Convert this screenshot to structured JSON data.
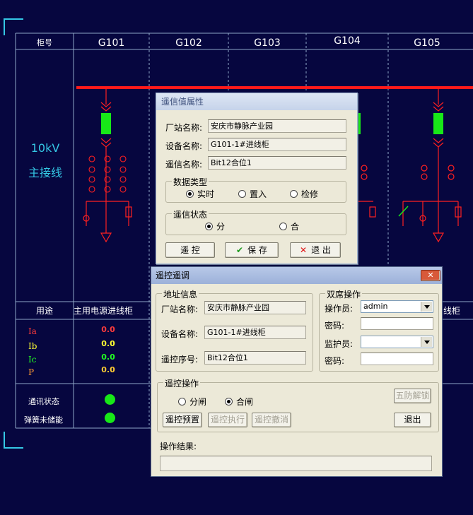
{
  "table": {
    "header_label": "柜号",
    "cabinets": [
      "G101",
      "G102",
      "G103",
      "G104",
      "G105"
    ],
    "bus_title_line1": "10kV",
    "bus_title_line2": "主接线",
    "purpose_label": "用途",
    "purpose_col1": "主用电源进线柜",
    "purpose_col5_partial": "线柜",
    "measurements": [
      {
        "label": "Ia",
        "value": "0.0",
        "label_color": "#ff3b3b",
        "value_color": "#ff3b3b"
      },
      {
        "label": "Ib",
        "value": "0.0",
        "label_color": "#ffff33",
        "value_color": "#ffff33"
      },
      {
        "label": "Ic",
        "value": "0.0",
        "label_color": "#22ff22",
        "value_color": "#22ff22"
      },
      {
        "label": "P",
        "value": "0.0",
        "label_color": "#ff9933",
        "value_color": "#ffcc33"
      }
    ],
    "comm_status_label": "通讯状态",
    "spring_label": "弹簧未储能",
    "led_color": "#18e818"
  },
  "telesignal_dialog": {
    "title": "遥信值属性",
    "station_label": "厂站名称:",
    "station_value": "安庆市静脉产业园",
    "device_label": "设备名称:",
    "device_value": "G101-1#进线柜",
    "signal_label": "遥信名称:",
    "signal_value": "Bit12合位1",
    "data_type_group": "数据类型",
    "data_type_options": [
      "实时",
      "置入",
      "检修"
    ],
    "data_type_selected": "实时",
    "status_group": "遥信状态",
    "status_options": [
      "分",
      "合"
    ],
    "status_selected": "分",
    "btn_remote": "遥 控",
    "btn_save": "保 存",
    "btn_exit": "退 出"
  },
  "remote_dialog": {
    "title": "遥控遥调",
    "addr_group": "地址信息",
    "station_label": "厂站名称:",
    "station_value": "安庆市静脉产业园",
    "device_label": "设备名称:",
    "device_value": "G101-1#进线柜",
    "seq_label": "遥控序号:",
    "seq_value": "Bit12合位1",
    "dual_group": "双席操作",
    "operator_label": "操作员:",
    "operator_value": "admin",
    "password1_label": "密码:",
    "supervisor_label": "监护员:",
    "supervisor_value": "",
    "password2_label": "密码:",
    "op_group": "遥控操作",
    "op_options": [
      "分闸",
      "合闸"
    ],
    "op_selected": "合闸",
    "btn_unlock": "五防解锁",
    "btn_preset": "遥控预置",
    "btn_execute": "遥控执行",
    "btn_cancel": "遥控撤消",
    "btn_exit": "退出",
    "result_label": "操作结果:",
    "result_value": ""
  }
}
